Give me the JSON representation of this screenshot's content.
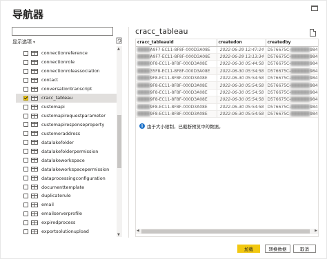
{
  "window": {
    "title": "导航器",
    "maximize_icon": "maximize-icon"
  },
  "left_pane": {
    "search": {
      "value": "",
      "placeholder": ""
    },
    "display_options": {
      "label": "显示选项",
      "chevron": "▾"
    },
    "refresh_icon": "refresh-icon",
    "items": [
      {
        "label": "connectionreference",
        "checked": false
      },
      {
        "label": "connectionrole",
        "checked": false
      },
      {
        "label": "connectionroleassociation",
        "checked": false
      },
      {
        "label": "contact",
        "checked": false
      },
      {
        "label": "conversationtranscript",
        "checked": false
      },
      {
        "label": "cracc_tableau",
        "checked": true
      },
      {
        "label": "customapi",
        "checked": false
      },
      {
        "label": "customapirequestparameter",
        "checked": false
      },
      {
        "label": "customapiresponseproperty",
        "checked": false
      },
      {
        "label": "customeraddress",
        "checked": false
      },
      {
        "label": "datalakefolder",
        "checked": false
      },
      {
        "label": "datalakefolderpermission",
        "checked": false
      },
      {
        "label": "datalakeworkspace",
        "checked": false
      },
      {
        "label": "datalakeworkspacepermission",
        "checked": false
      },
      {
        "label": "dataprocessingconfiguration",
        "checked": false
      },
      {
        "label": "documenttemplate",
        "checked": false
      },
      {
        "label": "duplicaterule",
        "checked": false
      },
      {
        "label": "email",
        "checked": false
      },
      {
        "label": "emailserverprofile",
        "checked": false
      },
      {
        "label": "expiredprocess",
        "checked": false
      },
      {
        "label": "exportsolutionupload",
        "checked": false
      }
    ]
  },
  "preview": {
    "title": "cracc_tableau",
    "export_icon": "export-icon",
    "columns": [
      "cracc_tableauid",
      "createdon",
      "createdby"
    ],
    "rows": [
      [
        "A9F7-EC11-8F8F-000D3A08E",
        "2022-06-29 12:47:24",
        "D576675C-"
      ],
      [
        "A9F7-EC11-8F8F-000D3A08E",
        "2022-06-29 13:13:34",
        "D576675C-"
      ],
      [
        "0F8-EC11-8F8F-000D3A08E",
        "2022-06-30 05:44:58",
        "D576675C-"
      ],
      [
        "35F8-EC11-8F8F-000D3A08E",
        "2022-06-30 05:54:58",
        "D576675C-"
      ],
      [
        "9F8-EC11-8F8F-000D3A08E",
        "2022-06-30 05:54:58",
        "D576675C-"
      ],
      [
        "9F8-EC11-8F8F-000D3A08E",
        "2022-06-30 05:54:58",
        "D576675C-"
      ],
      [
        "9F8-EC11-8F8F-000D3A08E",
        "2022-06-30 05:54:58",
        "D576675C-"
      ],
      [
        "9F8-EC11-8F8F-000D3A08E",
        "2022-06-30 05:54:58",
        "D576675C-"
      ],
      [
        "9F8-EC11-8F8F-000D3A08E",
        "2022-06-30 05:54:58",
        "D576675C-"
      ],
      [
        "9F8-EC11-8F8F-000D3A08E",
        "2022-06-30 05:54:58",
        "D576675C-"
      ]
    ],
    "row_suffix": "984",
    "info": {
      "icon": "info-icon",
      "text": "由于大小限制，已截断预览中的数据。"
    }
  },
  "footer": {
    "load_label": "加载",
    "transform_label": "转换数据",
    "cancel_label": "取消",
    "accent_color": "#f2c811"
  }
}
